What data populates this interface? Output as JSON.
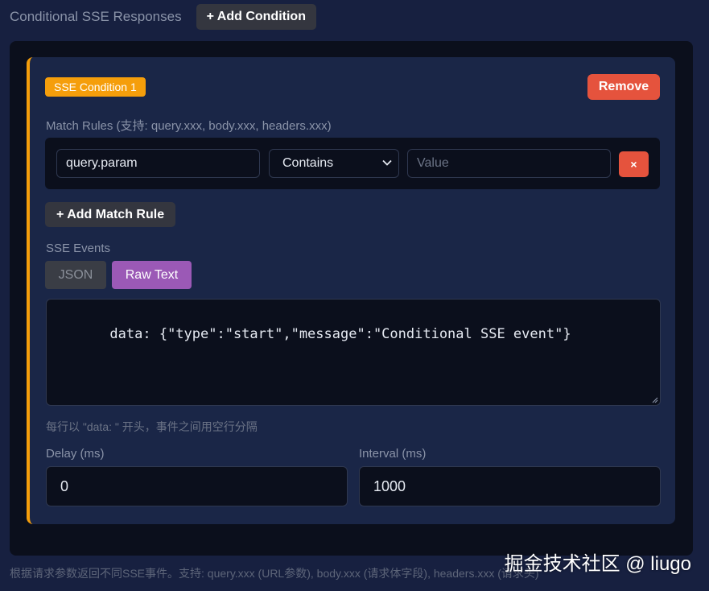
{
  "header": {
    "title": "Conditional SSE Responses",
    "add_condition_label": "+ Add Condition"
  },
  "condition": {
    "badge": "SSE Condition 1",
    "remove_label": "Remove",
    "match_rules_label": "Match Rules (支持: query.xxx, body.xxx, headers.xxx)",
    "rule": {
      "field_value": "query.param",
      "operator_value": "Contains",
      "value_placeholder": "Value",
      "delete_glyph": "×"
    },
    "add_rule_label": "+ Add Match Rule",
    "events_label": "SSE Events",
    "tabs": [
      {
        "label": "JSON",
        "active": false
      },
      {
        "label": "Raw Text",
        "active": true
      }
    ],
    "events_text": "data: {\"type\":\"start\",\"message\":\"Conditional SSE event\"}",
    "hint": "每行以 \"data: \" 开头，事件之间用空行分隔",
    "delay": {
      "label": "Delay (ms)",
      "value": "0"
    },
    "interval": {
      "label": "Interval (ms)",
      "value": "1000"
    }
  },
  "footnote": "根据请求参数返回不同SSE事件。支持: query.xxx (URL参数), body.xxx (请求体字段), headers.xxx (请求头)",
  "watermark": "掘金技术社区 @ liugo",
  "colors": {
    "background": "#172040",
    "card": "#1a2647",
    "accent_orange": "#f59e0b",
    "danger_red": "#e5533d",
    "active_tab_purple": "#9b59b6"
  },
  "icons": [
    "chevron-down-icon",
    "close-icon",
    "resize-handle-icon"
  ]
}
